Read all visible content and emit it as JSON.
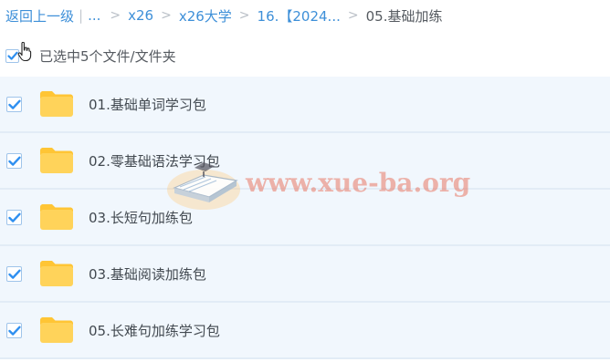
{
  "breadcrumb": {
    "back_label": "返回上一级",
    "ellipsis": "...",
    "separator_bar": "|",
    "items": [
      {
        "label": "x26"
      },
      {
        "label": "x26大学"
      },
      {
        "label": "16.【2024..."
      }
    ],
    "current": "05.基础加练",
    "chevron": ">"
  },
  "selection": {
    "label": "已选中5个文件/文件夹",
    "all_checked": true
  },
  "files": [
    {
      "name": "01.基础单词学习包",
      "checked": true,
      "type": "folder"
    },
    {
      "name": "02.零基础语法学习包",
      "checked": true,
      "type": "folder"
    },
    {
      "name": "03.长短句加练包",
      "checked": true,
      "type": "folder"
    },
    {
      "name": "03.基础阅读加练包",
      "checked": true,
      "type": "folder"
    },
    {
      "name": "05.长难句加练学习包",
      "checked": true,
      "type": "folder"
    }
  ],
  "watermark": {
    "text": "www.xue-ba.org"
  },
  "colors": {
    "link": "#3d8fd8",
    "row_bg": "#f1f7fd",
    "row_border": "#e2ecf6",
    "check": "#2e8ff0",
    "folder": "#ffd35a",
    "folder_tab": "#ffc535",
    "watermark": "#e87864"
  }
}
